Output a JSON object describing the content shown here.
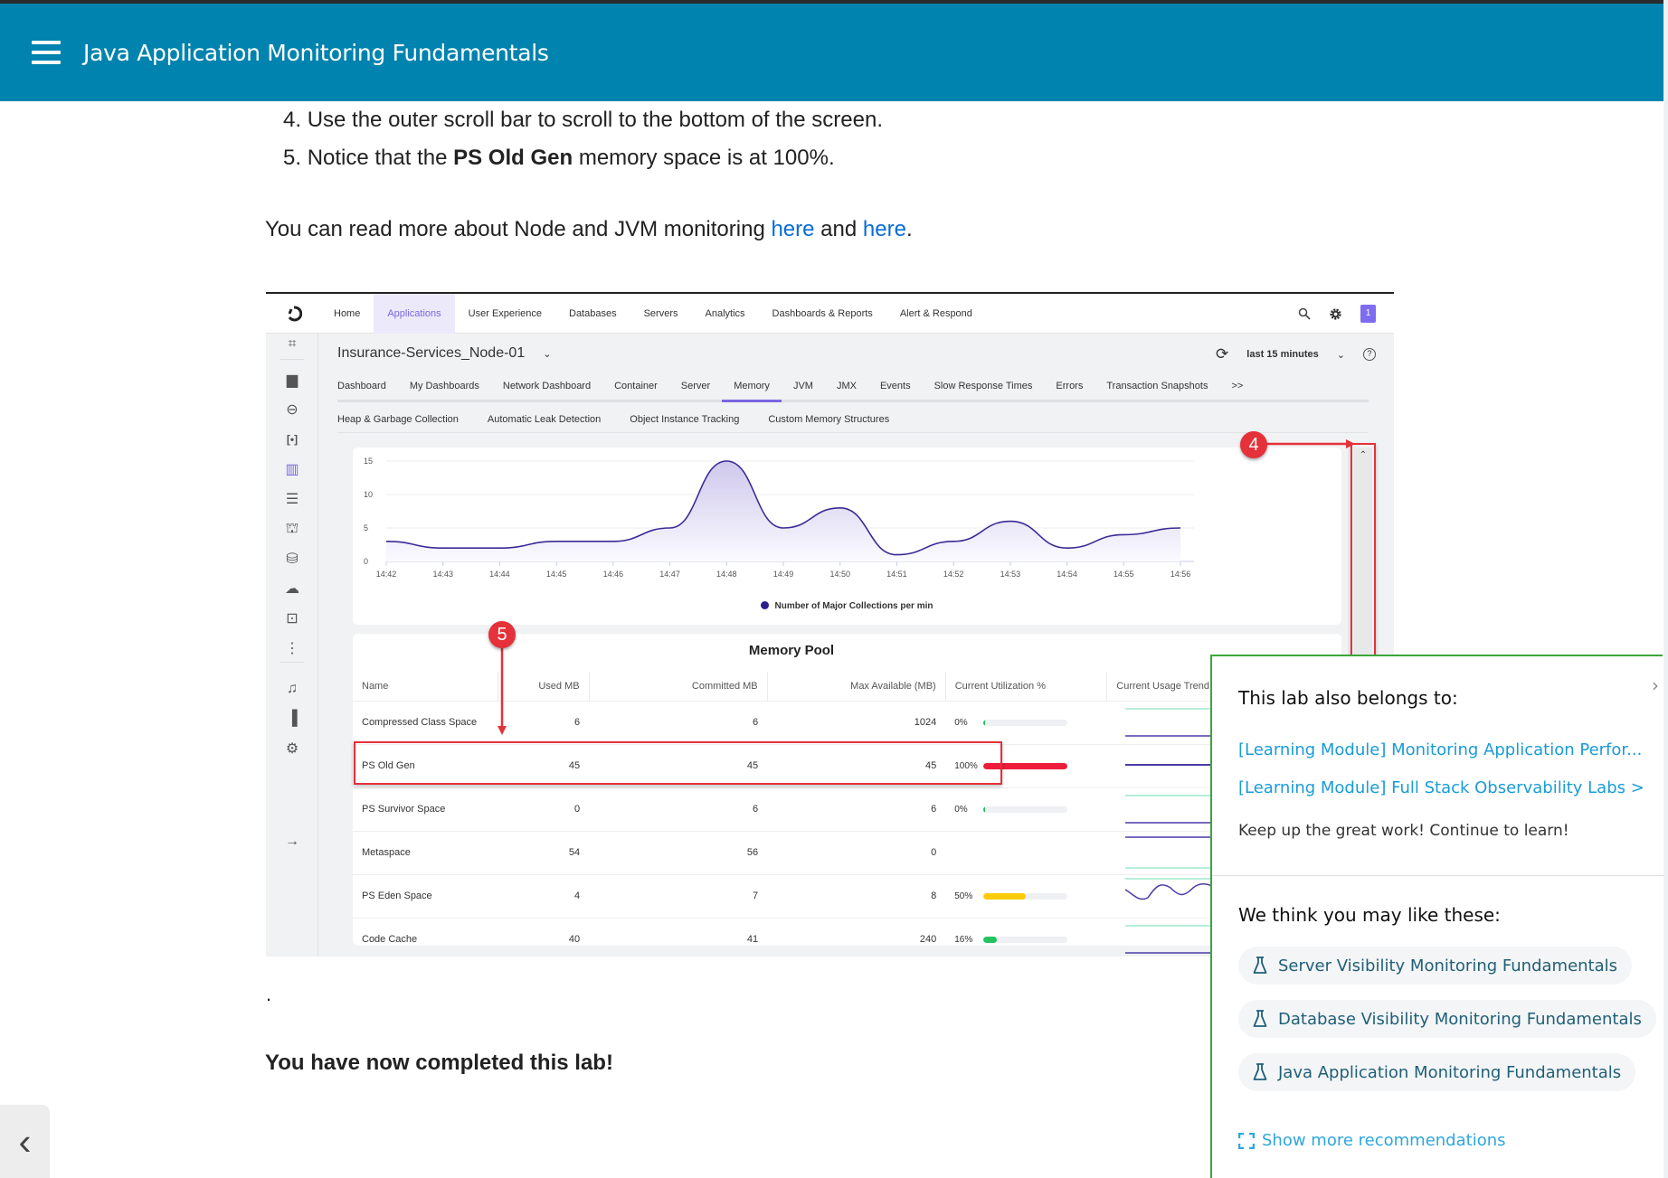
{
  "header": {
    "title": "Java Application Monitoring Fundamentals",
    "menu_icon": "hamburger-icon"
  },
  "steps": [
    {
      "num": "4.",
      "text": "Use the outer scroll bar to scroll to the bottom of the screen."
    },
    {
      "num": "5.",
      "pre": "Notice that the ",
      "bold": "PS Old Gen",
      "post": " memory space is at 100%."
    }
  ],
  "para": {
    "pre": "You can read more about Node and JVM monitoring ",
    "link1": "here",
    "mid": " and ",
    "link2": "here",
    "post": "."
  },
  "dot": ".",
  "completed": "You have now completed this lab!",
  "embedded": {
    "nav": [
      "Home",
      "Applications",
      "User Experience",
      "Databases",
      "Servers",
      "Analytics",
      "Dashboards & Reports",
      "Alert & Respond"
    ],
    "nav_active": "Applications",
    "badge": "1",
    "app_name": "Insurance-Services_Node-01",
    "time_range": "last 15 minutes",
    "tabs": [
      "Dashboard",
      "My Dashboards",
      "Network Dashboard",
      "Container",
      "Server",
      "Memory",
      "JVM",
      "JMX",
      "Events",
      "Slow Response Times",
      "Errors",
      "Transaction Snapshots",
      ">>"
    ],
    "tab_active": "Memory",
    "subtabs": [
      "Heap & Garbage Collection",
      "Automatic Leak Detection",
      "Object Instance Tracking",
      "Custom Memory Structures"
    ],
    "sidebar_icons": [
      "flow-map-icon",
      "dashboard-icon",
      "tiers-icon",
      "scan-icon",
      "nodes-icon",
      "servers-icon",
      "containers-icon",
      "database-icon",
      "cloud-upload-icon",
      "alert-screen-icon",
      "more-icon",
      "bell-icon",
      "analytics-icon",
      "settings-icon",
      "expand-arrow-icon"
    ],
    "markers": {
      "m4": "4",
      "m5": "5"
    },
    "memory_pool": {
      "title": "Memory Pool",
      "columns": [
        "Name",
        "Used MB",
        "Committed MB",
        "Max Available (MB)",
        "Current Utilization %",
        "Current Usage Trend"
      ],
      "rows": [
        {
          "name": "Compressed Class Space",
          "used": "6",
          "committed": "6",
          "max": "1024",
          "util": "0%",
          "util_value": 0,
          "color": "#23c35f"
        },
        {
          "name": "PS Old Gen",
          "used": "45",
          "committed": "45",
          "max": "45",
          "util": "100%",
          "util_value": 100,
          "color": "#ee1c3b"
        },
        {
          "name": "PS Survivor Space",
          "used": "0",
          "committed": "6",
          "max": "6",
          "util": "0%",
          "util_value": 0,
          "color": "#23c35f"
        },
        {
          "name": "Metaspace",
          "used": "54",
          "committed": "56",
          "max": "0",
          "util": "",
          "util_value": null,
          "color": ""
        },
        {
          "name": "PS Eden Space",
          "used": "4",
          "committed": "7",
          "max": "8",
          "util": "50%",
          "util_value": 50,
          "color": "#fccc0a"
        },
        {
          "name": "Code Cache",
          "used": "40",
          "committed": "41",
          "max": "240",
          "util": "16%",
          "util_value": 16,
          "color": "#23c35f"
        }
      ]
    }
  },
  "chart_data": {
    "type": "area",
    "title": "",
    "x": [
      "14:42",
      "14:43",
      "14:44",
      "14:45",
      "14:46",
      "14:47",
      "14:48",
      "14:49",
      "14:50",
      "14:51",
      "14:52",
      "14:53",
      "14:54",
      "14:55",
      "14:56"
    ],
    "series": [
      {
        "name": "Number of Major Collections per min",
        "values": [
          3,
          2,
          2,
          3,
          3,
          5,
          15,
          5,
          8,
          1,
          3,
          6,
          2,
          4,
          5
        ],
        "color": "#3b2a96"
      }
    ],
    "yticks": [
      0,
      5,
      10,
      15
    ],
    "ylim": [
      0,
      15
    ],
    "xlabel": "",
    "ylabel": "",
    "grid": true,
    "legend": "bottom"
  },
  "popup": {
    "belongs_title": "This lab also belongs to:",
    "links": [
      "[Learning Module] Monitoring Application Perfor...",
      "[Learning Module] Full Stack Observability Labs >"
    ],
    "note": "Keep up the great work! Continue to learn!",
    "recommend_title": "We think you may like these:",
    "recommendations": [
      "Server Visibility Monitoring Fundamentals",
      "Database Visibility Monitoring Fundamentals",
      "Java Application Monitoring Fundamentals"
    ],
    "show_more": "Show more recommendations",
    "close_glyph": "›"
  },
  "back_glyph": "‹"
}
